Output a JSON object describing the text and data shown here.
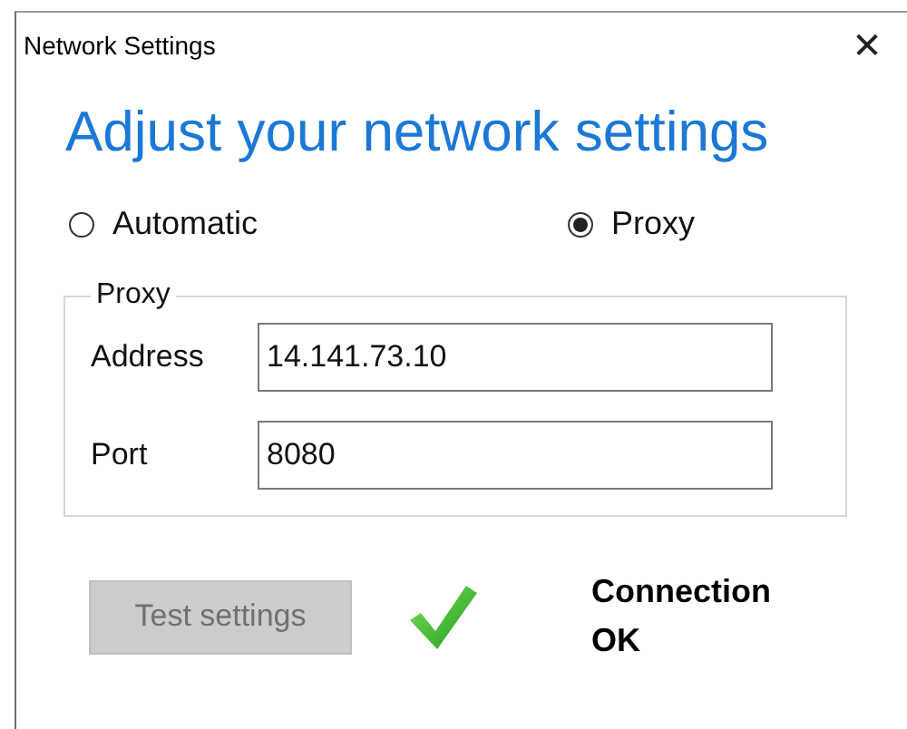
{
  "window": {
    "title": "Network Settings",
    "close": "✕"
  },
  "heading": "Adjust your network settings",
  "mode_options": [
    {
      "label": "Automatic",
      "selected": false
    },
    {
      "label": "Proxy",
      "selected": true
    }
  ],
  "proxy_group": {
    "legend": "Proxy",
    "fields": [
      {
        "label": "Address",
        "value": "14.141.73.10"
      },
      {
        "label": "Port",
        "value": "8080"
      }
    ]
  },
  "test_button": {
    "label": "Test settings",
    "disabled": true
  },
  "status": {
    "kind": "ok",
    "text": "Connection OK"
  }
}
